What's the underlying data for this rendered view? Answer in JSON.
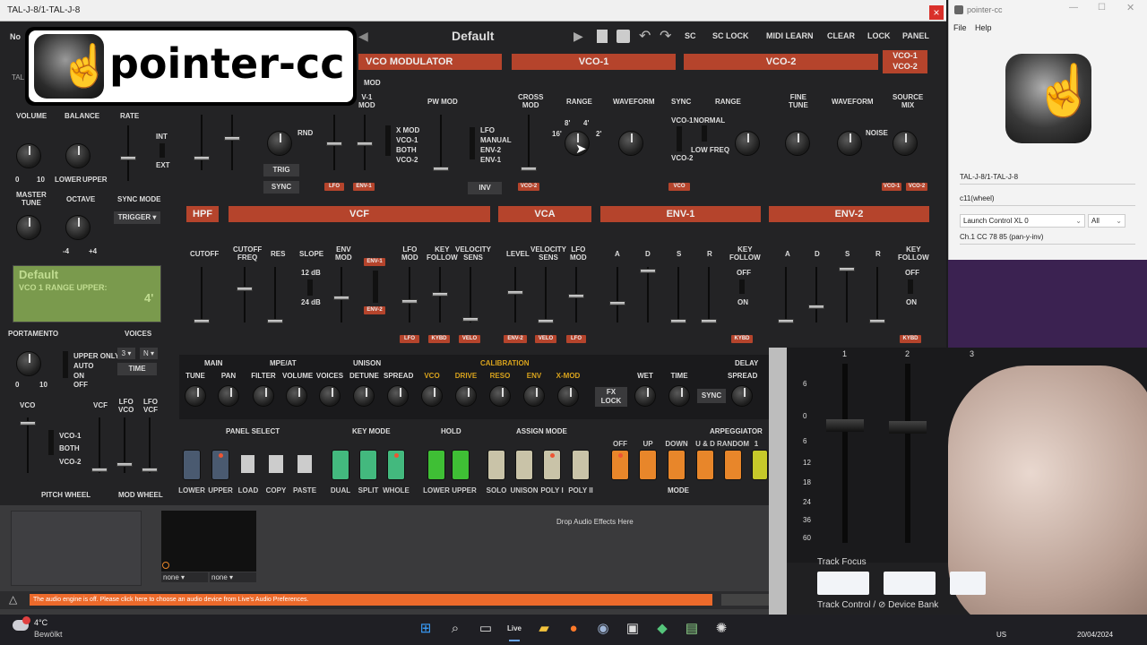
{
  "title_bar": {
    "title": "TAL-J-8/1-TAL-J-8",
    "close": "×"
  },
  "logo": {
    "text": "pointer-cc"
  },
  "plugin": {
    "preset_name": "Default",
    "toolbar": [
      "SC",
      "SC LOCK",
      "MIDI LEARN",
      "CLEAR",
      "LOCK",
      "PANEL"
    ],
    "fragments": {
      "no": "No",
      "tal": "TAL"
    },
    "sections_top": {
      "vco_modulator": "VCO MODULATOR",
      "vco1": "VCO-1",
      "vco2": "VCO-2",
      "vco12": "VCO-1\nVCO-2"
    },
    "sections_mid": {
      "hpf": "HPF",
      "vcf": "VCF",
      "vca": "VCA",
      "env1": "ENV-1",
      "env2": "ENV-2"
    },
    "left_labels": {
      "volume": "VOLUME",
      "balance": "BALANCE",
      "rate": "RATE",
      "lower": "LOWER",
      "upper": "UPPER",
      "master_tune": "MASTER\nTUNE",
      "octave": "OCTAVE",
      "sync_mode": "SYNC MODE",
      "trigger": "TRIGGER ▾",
      "int": "INT",
      "ext": "EXT",
      "zero": "0",
      "ten": "10",
      "minus4": "-4",
      "plus4": "+4"
    },
    "display": {
      "line1": "Default",
      "line2": "VCO 1 RANGE UPPER:",
      "value": "4'"
    },
    "portamento": {
      "label": "PORTAMENTO",
      "voices": "VOICES",
      "upper_only": "UPPER ONLY",
      "auto": "AUTO",
      "on": "ON",
      "off": "OFF",
      "voices_val": "3 ▾",
      "n_val": "N ▾",
      "time": "TIME"
    },
    "wheels": {
      "vco": "VCO",
      "vcf": "VCF",
      "lfo_vco": "LFO\nVCO",
      "lfo_vcf": "LFO\nVCF",
      "pitch": "PITCH WHEEL",
      "mod": "MOD WHEEL",
      "vco1": "VCO-1",
      "both": "BOTH",
      "vco2": "VCO-2"
    },
    "vcomod": {
      "mod": "MOD",
      "v1mod": "V-1\nMOD",
      "pw_mod": "PW MOD",
      "trig": "TRIG",
      "sync": "SYNC",
      "rnd": "RND",
      "xmod": "X MOD",
      "vco1": "VCO-1",
      "both": "BOTH",
      "vco2": "VCO-2",
      "lfo": "LFO",
      "manual": "MANUAL",
      "env2": "ENV-2",
      "env1": "ENV-1",
      "inv": "INV",
      "tag_lfo": "LFO",
      "tag_env1": "ENV-1",
      "tag_vco2": "VCO-2"
    },
    "vco1_labels": {
      "cross_mod": "CROSS\nMOD",
      "range": "RANGE",
      "waveform": "WAVEFORM",
      "sync": "SYNC",
      "r8": "8'",
      "r4": "4'",
      "r2": "2'",
      "r16": "16'"
    },
    "vco2_labels": {
      "range": "RANGE",
      "fine_tune": "FINE\nTUNE",
      "waveform": "WAVEFORM",
      "source_mix": "SOURCE\nMIX",
      "normal": "NORMAL",
      "low_freq": "LOW FREQ",
      "vco1": "VCO-1",
      "vco2": "VCO-2",
      "noise": "NOISE",
      "tag_vco": "VCO",
      "tag_vco1": "VCO-1",
      "tag_vco2": "VCO-2"
    },
    "filter_labels": {
      "cutoff": "CUTOFF",
      "cutoff_freq": "CUTOFF\nFREQ",
      "res": "RES",
      "slope": "SLOPE",
      "env_mod": "ENV\nMOD",
      "lfo_mod": "LFO\nMOD",
      "key_follow": "KEY\nFOLLOW",
      "velocity_sens": "VELOCITY\nSENS",
      "db12": "12 dB",
      "db24": "24 dB",
      "tag_env1": "ENV-1",
      "tag_env2": "ENV-2",
      "tag_lfo": "LFO",
      "tag_kybd": "KYBD",
      "tag_velo": "VELO"
    },
    "vca_labels": {
      "level": "LEVEL",
      "velocity_sens": "VELOCITY\nSENS",
      "lfo_mod": "LFO\nMOD",
      "tag_env2": "ENV-2",
      "tag_velo": "VELO",
      "tag_lfo": "LFO"
    },
    "env_labels": {
      "a": "A",
      "d": "D",
      "s": "S",
      "r": "R",
      "key_follow": "KEY\nFOLLOW",
      "off": "OFF",
      "on": "ON",
      "tag_kybd": "KYBD"
    },
    "bottom": {
      "main": "MAIN",
      "mpe_at": "MPE/AT",
      "unison": "UNISON",
      "calibration": "CALIBRATION",
      "delay": "DELAY",
      "knobs": [
        "TUNE",
        "PAN",
        "FILTER",
        "VOLUME",
        "VOICES",
        "DETUNE",
        "SPREAD",
        "VCO",
        "DRIVE",
        "RESO",
        "ENV",
        "X-MOD",
        "WET",
        "TIME",
        "SPREAD"
      ],
      "fx_lock": "FX\nLOCK",
      "sync": "SYNC"
    },
    "buttons": {
      "panel_select": "PANEL SELECT",
      "key_mode": "KEY MODE",
      "hold": "HOLD",
      "assign_mode": "ASSIGN MODE",
      "arpeggiator": "ARPEGGIATOR",
      "mode": "MODE",
      "panel": [
        "LOWER",
        "UPPER",
        "LOAD",
        "COPY",
        "PASTE"
      ],
      "key": [
        "DUAL",
        "SPLIT",
        "WHOLE"
      ],
      "hold_btns": [
        "LOWER",
        "UPPER"
      ],
      "assign": [
        "SOLO",
        "UNISON",
        "POLY I",
        "POLY II"
      ],
      "arp": [
        "OFF",
        "UP",
        "DOWN",
        "U & D",
        "RANDOM",
        "1"
      ]
    }
  },
  "live": {
    "drop_text": "Drop Audio Effects Here",
    "none1": "none",
    "none2": "none",
    "warning": "The audio engine is off. Please click here to choose an audio device from Live's Audio Preferences."
  },
  "pcc_window": {
    "title": "pointer-cc",
    "menu_file": "File",
    "menu_help": "Help",
    "plugin_name": "TAL-J-8/1-TAL-J-8",
    "control": "c11(wheel)",
    "midi_device": "Launch Control XL 0",
    "channel_filter": "All",
    "mapping": "Ch.1 CC 78 85 (pan-y-inv)"
  },
  "hardware": {
    "track_focus": "Track Focus",
    "track_control": "Track Control / ⊘ Device Bank",
    "nums": [
      "1",
      "2",
      "3"
    ],
    "scale": [
      "6",
      "0",
      "6",
      "12",
      "18",
      "24",
      "36",
      "60"
    ]
  },
  "taskbar": {
    "temp": "4°C",
    "weather": "Bewölkt",
    "lang": "US",
    "date": "20/04/2024",
    "live": "Live"
  },
  "colors": {
    "accent": "#b5442c",
    "panel_bg": "#232325"
  }
}
